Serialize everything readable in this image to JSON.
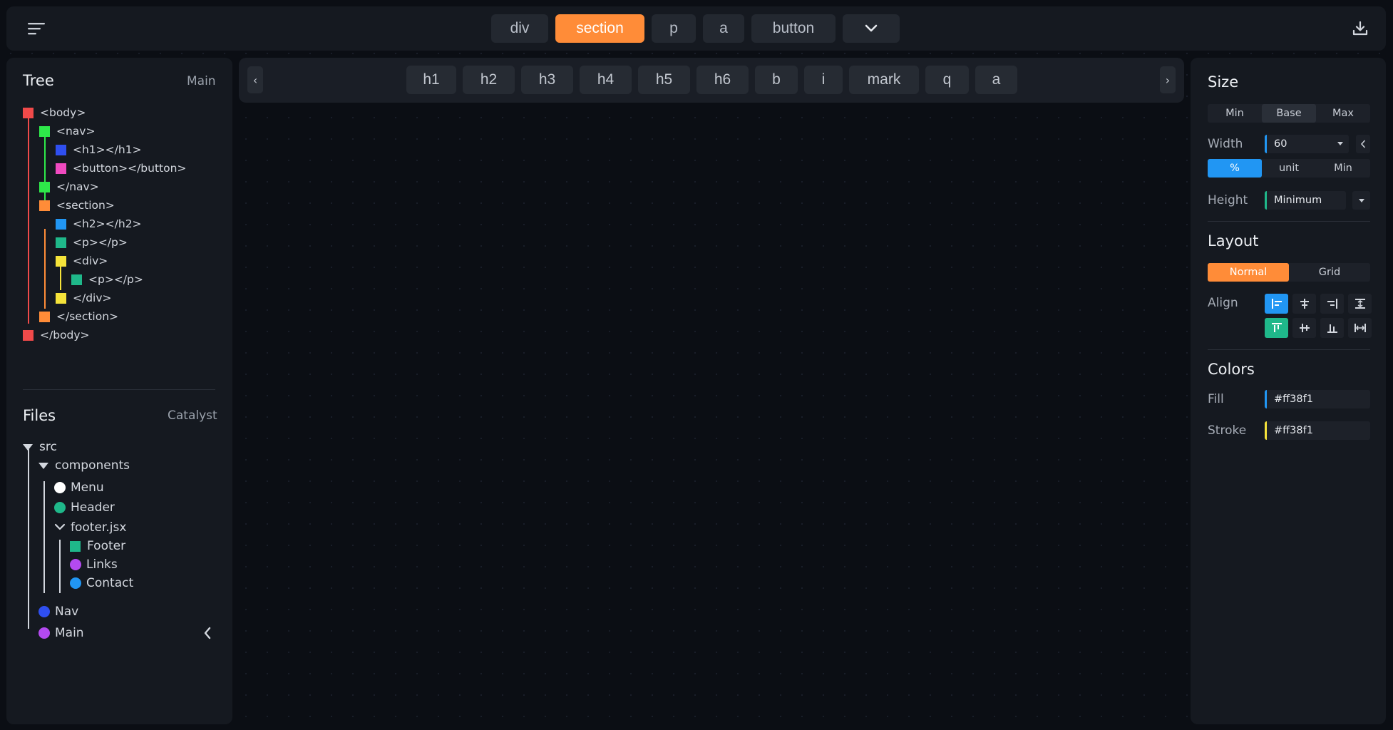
{
  "topbar": {
    "tags": [
      {
        "label": "div",
        "active": false
      },
      {
        "label": "section",
        "active": true
      },
      {
        "label": "p",
        "active": false
      },
      {
        "label": "a",
        "active": false
      },
      {
        "label": "button",
        "active": false
      }
    ],
    "menu_icon": "menu-lines-icon",
    "more_icon": "chevron-down-icon",
    "download_icon": "download-icon"
  },
  "subbar": {
    "tags": [
      "h1",
      "h2",
      "h3",
      "h4",
      "h5",
      "h6",
      "b",
      "i",
      "mark",
      "q",
      "a"
    ],
    "left_arrow": "‹",
    "right_arrow": "›"
  },
  "tree": {
    "title": "Tree",
    "subtitle": "Main",
    "nodes": [
      {
        "label": "<body>",
        "color": "#f04a4a"
      },
      {
        "label": "<nav>",
        "color": "#2ee84a"
      },
      {
        "label": "<h1></h1>",
        "color": "#2f4ff0"
      },
      {
        "label": "<button></button>",
        "color": "#f04ac0"
      },
      {
        "label": "</nav>",
        "color": "#2ee84a"
      },
      {
        "label": "<section>",
        "color": "#ff8c38"
      },
      {
        "label": "<h2></h2>",
        "color": "#2196f3"
      },
      {
        "label": "<p></p>",
        "color": "#1fb88a"
      },
      {
        "label": "<div>",
        "color": "#f5e33a"
      },
      {
        "label": "<p></p>",
        "color": "#1fb88a"
      },
      {
        "label": "</div>",
        "color": "#f5e33a"
      },
      {
        "label": "</section>",
        "color": "#ff8c38"
      },
      {
        "label": "</body>",
        "color": "#f04a4a"
      }
    ]
  },
  "files": {
    "title": "Files",
    "subtitle": "Catalyst",
    "items": [
      {
        "label": "src",
        "kind": "folder-open"
      },
      {
        "label": "components",
        "kind": "folder-open"
      },
      {
        "label": "Menu",
        "kind": "dot",
        "color": "#ffffff"
      },
      {
        "label": "Header",
        "kind": "dot",
        "color": "#1fb88a"
      },
      {
        "label": "footer.jsx",
        "kind": "chevron"
      },
      {
        "label": "Footer",
        "kind": "square",
        "color": "#1fb88a"
      },
      {
        "label": "Links",
        "kind": "dot",
        "color": "#b44af0"
      },
      {
        "label": "Contact",
        "kind": "dot",
        "color": "#2196f3"
      },
      {
        "label": "Nav",
        "kind": "dot",
        "color": "#2f4ff0"
      },
      {
        "label": "Main",
        "kind": "dot",
        "color": "#b44af0"
      }
    ],
    "collapse_icon": "chevron-left-icon"
  },
  "size": {
    "title": "Size",
    "modes": [
      "Min",
      "Base",
      "Max"
    ],
    "active_mode": "Base",
    "width_label": "Width",
    "width_value": "60",
    "unit_options": [
      "%",
      "unit",
      "Min"
    ],
    "active_unit": "%",
    "height_label": "Height",
    "height_value": "Minimum"
  },
  "layout": {
    "title": "Layout",
    "modes": [
      "Normal",
      "Grid"
    ],
    "active_mode": "Normal",
    "align_label": "Align"
  },
  "colors": {
    "title": "Colors",
    "fill_label": "Fill",
    "fill_value": "#ff38f1",
    "stroke_label": "Stroke",
    "stroke_value": "#ff38f1",
    "fill_bar": "#2196f3",
    "stroke_bar": "#f5e33a"
  }
}
